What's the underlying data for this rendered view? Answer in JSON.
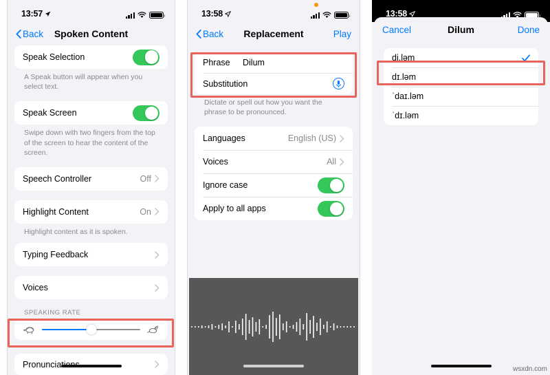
{
  "panel1": {
    "status": {
      "time": "13:57",
      "location_icon": "location-arrow-icon",
      "signal_icon": "cellular-bars-icon",
      "wifi_icon": "wifi-icon",
      "battery_icon": "battery-icon"
    },
    "nav": {
      "back_label": "Back",
      "title": "Spoken Content"
    },
    "rows": [
      {
        "label": "Speak Selection",
        "control": "toggle",
        "state": "on"
      },
      {
        "label": "Speak Screen",
        "control": "toggle",
        "state": "on"
      },
      {
        "label": "Speech Controller",
        "value": "Off",
        "control": "chevron"
      },
      {
        "label": "Highlight Content",
        "value": "On",
        "control": "chevron"
      },
      {
        "label": "Typing Feedback",
        "value": "",
        "control": "chevron"
      },
      {
        "label": "Voices",
        "value": "",
        "control": "chevron"
      },
      {
        "label": "Pronunciations",
        "value": "",
        "control": "chevron"
      }
    ],
    "footnotes": {
      "speak_selection": "A Speak button will appear when you select text.",
      "speak_screen": "Swipe down with two fingers from the top of the screen to hear the content of the screen.",
      "highlight_content": "Highlight content as it is spoken."
    },
    "speaking_rate": {
      "header": "SPEAKING RATE",
      "slow_icon": "tortoise-icon",
      "fast_icon": "hare-icon",
      "percent": 50
    }
  },
  "panel2": {
    "status": {
      "time": "13:58",
      "location_icon": "location-arrow-icon",
      "recording_indicator": "orange-dot-icon",
      "signal_icon": "cellular-bars-icon",
      "wifi_icon": "wifi-icon",
      "battery_icon": "battery-icon"
    },
    "nav": {
      "back_label": "Back",
      "title": "Replacement",
      "right_label": "Play"
    },
    "fields": [
      {
        "label": "Phrase",
        "value": "Dilum"
      },
      {
        "label": "Substitution",
        "value": "",
        "accessory": "microphone-icon"
      }
    ],
    "footnote": "Dictate or spell out how you want the phrase to be pronounced.",
    "rows": [
      {
        "label": "Languages",
        "value": "English (US)",
        "control": "chevron"
      },
      {
        "label": "Voices",
        "value": "All",
        "control": "chevron"
      },
      {
        "label": "Ignore case",
        "control": "toggle",
        "state": "on"
      },
      {
        "label": "Apply to all apps",
        "control": "toggle",
        "state": "on"
      }
    ],
    "dictation": {
      "icon": "waveform-icon"
    }
  },
  "panel3": {
    "status": {
      "time": "13:58",
      "location_icon": "location-arrow-icon",
      "signal_icon": "cellular-bars-icon",
      "wifi_icon": "wifi-icon",
      "battery_icon": "battery-icon"
    },
    "nav": {
      "cancel_label": "Cancel",
      "title": "Dilum",
      "done_label": "Done"
    },
    "options": [
      {
        "label": "di.ləm",
        "selected": true
      },
      {
        "label": "dɪ.ləm",
        "selected": false
      },
      {
        "label": "ˈdaɪ.ləm",
        "selected": false
      },
      {
        "label": "ˈdɪ.ləm",
        "selected": false
      }
    ],
    "check_icon": "checkmark-icon"
  },
  "watermark": "wsxdn.com",
  "colors": {
    "accent_blue": "#007aff",
    "toggle_green": "#34c759",
    "annotation_red": "#e8635a",
    "group_bg": "#f2f2f7",
    "card_bg": "#ffffff",
    "recording_orange": "#ff9500"
  }
}
